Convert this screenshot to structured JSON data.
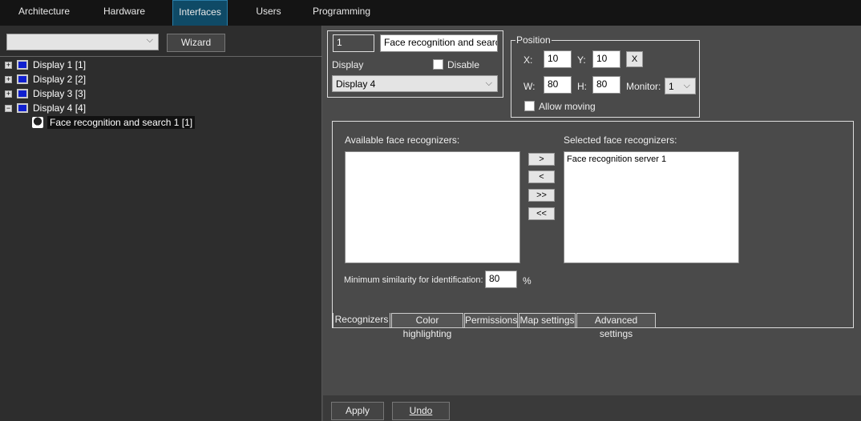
{
  "tabs": [
    "Architecture",
    "Hardware",
    "Interfaces",
    "Users",
    "Programming"
  ],
  "active_tab": "Interfaces",
  "left": {
    "combo_value": "",
    "wizard_label": "Wizard",
    "tree": [
      {
        "label": "Display 1 [1]",
        "expander": "+"
      },
      {
        "label": "Display 2 [2]",
        "expander": "+"
      },
      {
        "label": "Display 3 [3]",
        "expander": "+"
      },
      {
        "label": "Display 4 [4]",
        "expander": "−"
      }
    ],
    "child": "Face recognition and search 1 [1]"
  },
  "object": {
    "id": "1",
    "name": "Face recognition and search 1",
    "display_label": "Display",
    "disable_label": "Disable",
    "display_value": "Display 4"
  },
  "position": {
    "title": "Position",
    "x_label": "X:",
    "x": "10",
    "y_label": "Y:",
    "y": "10",
    "clear": "X",
    "w_label": "W:",
    "w": "80",
    "h_label": "H:",
    "h": "80",
    "monitor_label": "Monitor:",
    "monitor": "1",
    "allow_moving": "Allow moving"
  },
  "recognizers": {
    "available_label": "Available face recognizers:",
    "selected_label": "Selected face recognizers:",
    "available": [],
    "selected": [
      "Face recognition server 1"
    ],
    "buttons": [
      ">",
      "<",
      ">>",
      "<<"
    ],
    "similarity_label": "Minimum similarity for identification:",
    "similarity": "80",
    "percent": "%"
  },
  "bottom_tabs": [
    "Recognizers",
    "Color highlighting",
    "Permissions",
    "Map settings",
    "Advanced settings"
  ],
  "footer": {
    "apply": "Apply",
    "undo": "Undo"
  }
}
